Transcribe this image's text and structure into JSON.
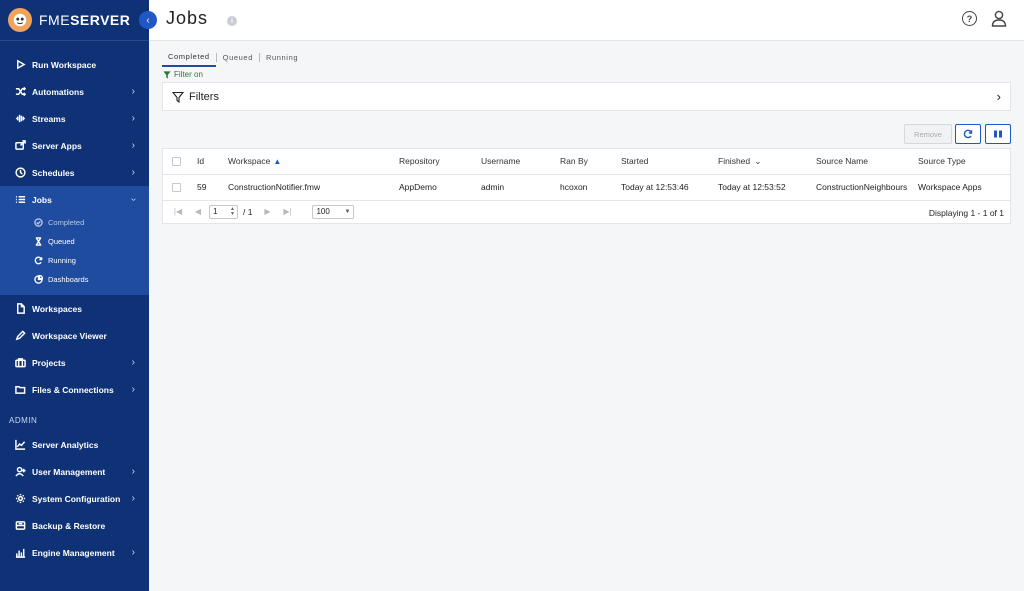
{
  "app": {
    "brand_prefix": "FME",
    "brand_suffix": "SERVER"
  },
  "header": {
    "title": "Jobs"
  },
  "sidebar": {
    "items": [
      {
        "label": "Run Workspace",
        "icon": "play-icon",
        "chevron": false
      },
      {
        "label": "Automations",
        "icon": "shuffle-icon",
        "chevron": true
      },
      {
        "label": "Streams",
        "icon": "stream-icon",
        "chevron": true
      },
      {
        "label": "Server Apps",
        "icon": "server-apps-icon",
        "chevron": true
      },
      {
        "label": "Schedules",
        "icon": "clock-icon",
        "chevron": true
      },
      {
        "label": "Jobs",
        "icon": "list-icon",
        "chevron": true
      }
    ],
    "jobs_sub": [
      {
        "label": "Completed",
        "icon": "check-circle-icon"
      },
      {
        "label": "Queued",
        "icon": "hourglass-icon"
      },
      {
        "label": "Running",
        "icon": "refresh-icon"
      },
      {
        "label": "Dashboards",
        "icon": "pie-chart-icon"
      }
    ],
    "items2": [
      {
        "label": "Workspaces",
        "icon": "file-icon",
        "chevron": false
      },
      {
        "label": "Workspace Viewer",
        "icon": "pen-icon",
        "chevron": false
      },
      {
        "label": "Projects",
        "icon": "briefcase-icon",
        "chevron": true
      },
      {
        "label": "Files & Connections",
        "icon": "folder-icon",
        "chevron": true
      }
    ],
    "admin_label": "ADMIN",
    "admin_items": [
      {
        "label": "Server Analytics",
        "icon": "analytics-icon",
        "chevron": false
      },
      {
        "label": "User Management",
        "icon": "user-add-icon",
        "chevron": true
      },
      {
        "label": "System Configuration",
        "icon": "gear-icon",
        "chevron": true
      },
      {
        "label": "Backup & Restore",
        "icon": "backup-icon",
        "chevron": false
      },
      {
        "label": "Engine Management",
        "icon": "engine-icon",
        "chevron": true
      }
    ]
  },
  "tabs": [
    "Completed",
    "Queued",
    "Running"
  ],
  "filter_on_label": "Filter on",
  "filters_label": "Filters",
  "toolbar": {
    "remove_label": "Remove"
  },
  "table": {
    "columns": [
      "Id",
      "Workspace",
      "Repository",
      "Username",
      "Ran By",
      "Started",
      "Finished",
      "Source Name",
      "Source Type"
    ],
    "rows": [
      [
        "59",
        "ConstructionNotifier.fmw",
        "AppDemo",
        "admin",
        "hcoxon",
        "Today at 12:53:46",
        "Today at 12:53:52",
        "ConstructionNeighbours",
        "Workspace Apps"
      ]
    ]
  },
  "pager": {
    "page": "1",
    "of": "/ 1",
    "page_size": "100",
    "display_info": "Displaying 1 - 1 of 1"
  },
  "colors": {
    "sidebar": "#0f3277",
    "sidebar_active": "#1f4c9e",
    "accent": "#1f57c7",
    "filter_green": "#2a7a3a"
  }
}
